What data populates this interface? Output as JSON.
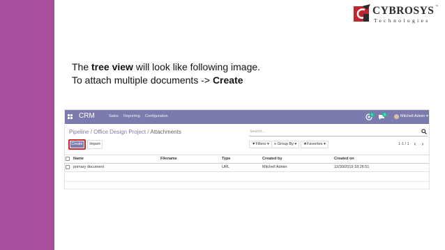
{
  "colors": {
    "left_bar": "#a94f9e",
    "odoo_purple": "#7c7bad",
    "highlight": "#d0242a",
    "badge_green": "#21b799",
    "logo_red": "#c0262d"
  },
  "logo": {
    "name": "CYBROSYS",
    "tm": "™",
    "subtitle": "Technologies"
  },
  "caption": {
    "line1_pre": "The ",
    "line1_bold": "tree view",
    "line1_post": " will look like following image.",
    "line2_pre": "To attach multiple documents -> ",
    "line2_bold": "Create"
  },
  "app": {
    "topbar": {
      "apps_icon": "grid-icon",
      "brand": "CRM",
      "menu": [
        "Sales",
        "Reporting",
        "Configuration"
      ],
      "chat_badge": "1",
      "activity_badge": "3",
      "user": "Mitchell Admin ▾"
    },
    "breadcrumb": {
      "items": [
        "Pipeline",
        "Office Design Project"
      ],
      "separator": " / ",
      "current": "Attachments"
    },
    "search": {
      "placeholder": "Search...",
      "icon": "search-icon"
    },
    "buttons": {
      "create": "Create",
      "import": "Import"
    },
    "filters": {
      "filters_label": "Filters",
      "groupby_label": "Group By",
      "favorites_label": "Favorites"
    },
    "pager": {
      "text": "1-1 / 1",
      "prev": "‹",
      "next": "›"
    },
    "table": {
      "columns": [
        "Name",
        "Filename",
        "Type",
        "Created by",
        "Created on"
      ],
      "rows": [
        {
          "name": "primary document",
          "filename": "",
          "type": "URL",
          "created_by": "Mitchell Admin",
          "created_on": "12/30/2019 18:26:51"
        }
      ]
    }
  }
}
